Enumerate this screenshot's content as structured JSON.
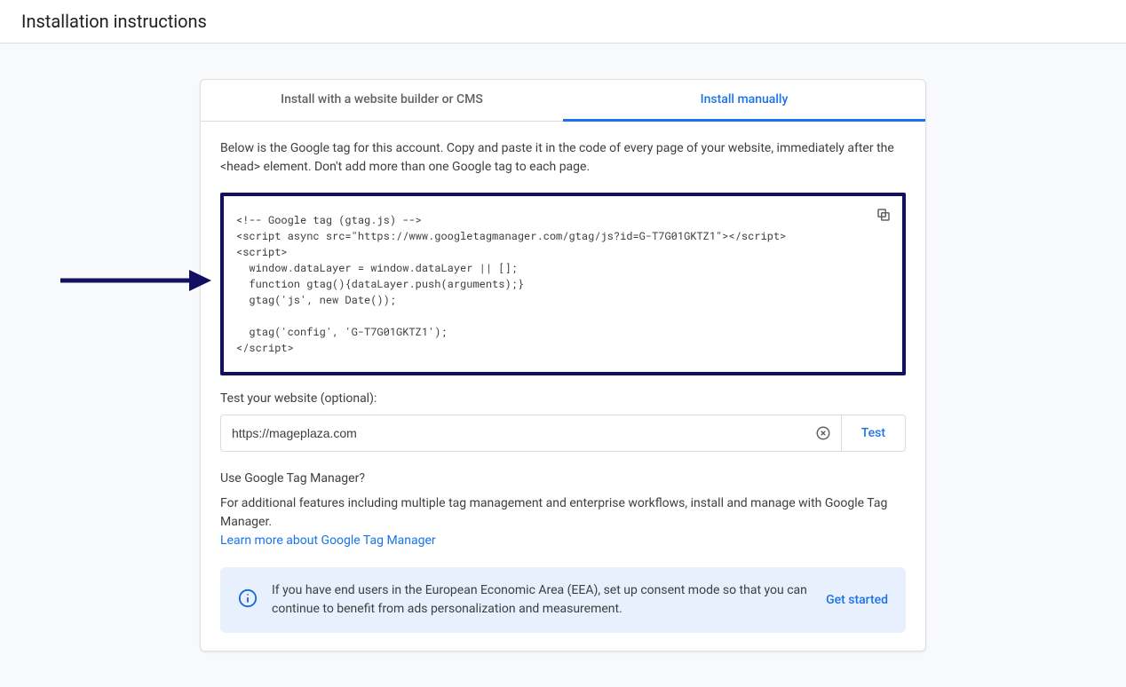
{
  "header": {
    "title": "Installation instructions"
  },
  "tabs": {
    "builder": "Install with a website builder or CMS",
    "manual": "Install manually"
  },
  "descText": "Below is the Google tag for this account. Copy and paste it in the code of every page of your website, immediately after the <head> element. Don't add more than one Google tag to each page.",
  "code": "<!-- Google tag (gtag.js) -->\n<script async src=\"https://www.googletagmanager.com/gtag/js?id=G-T7G01GKTZ1\"></script>\n<script>\n  window.dataLayer = window.dataLayer || [];\n  function gtag(){dataLayer.push(arguments);}\n  gtag('js', new Date());\n\n  gtag('config', 'G-T7G01GKTZ1');\n</script>",
  "test": {
    "label": "Test your website (optional):",
    "value": "https://mageplaza.com",
    "button": "Test"
  },
  "gtm": {
    "heading": "Use Google Tag Manager?",
    "body": "For additional features including multiple tag management and enterprise workflows, install and manage with Google Tag Manager.",
    "link": "Learn more about Google Tag Manager"
  },
  "banner": {
    "text": "If you have end users in the European Economic Area (EEA), set up consent mode so that you can continue to benefit from ads personalization and measurement.",
    "cta": "Get started"
  }
}
